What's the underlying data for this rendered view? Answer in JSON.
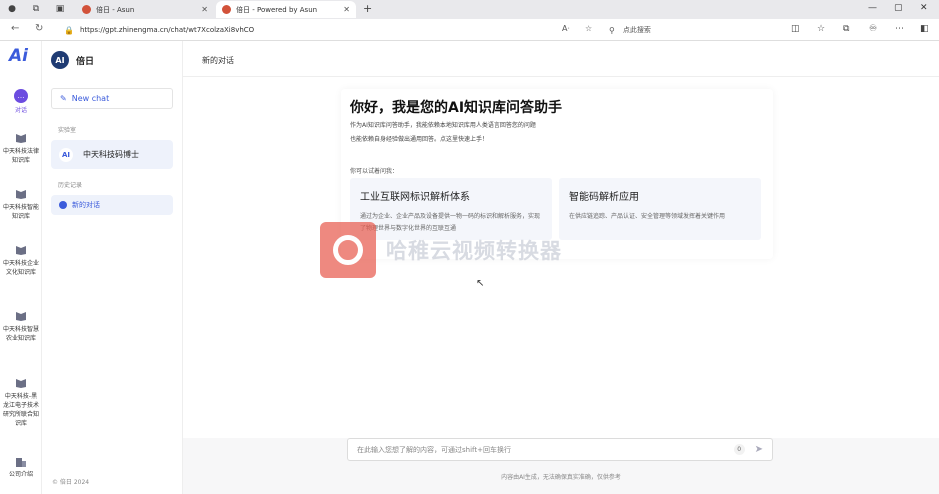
{
  "browser": {
    "tabs": [
      {
        "title": "倍日 - Asun",
        "active": false
      },
      {
        "title": "倍日 - Powered by Asun",
        "active": true
      }
    ],
    "url": "https://gpt.zhinengma.cn/chat/wt7XcolzaXi8vhCO",
    "search_placeholder": "点此搜索"
  },
  "rail": {
    "logo": "Ai",
    "items": [
      {
        "label": "对话",
        "icon": "chat-icon",
        "active": true
      },
      {
        "label": "中天科技法律知识库",
        "icon": "book-icon"
      },
      {
        "label": "中天科技智能知识库",
        "icon": "book-icon"
      },
      {
        "label": "中天科技企业文化知识库",
        "icon": "book-icon"
      },
      {
        "label": "中天科技智慧农业知识库",
        "icon": "book-icon"
      },
      {
        "label": "中天科技-黑龙江电子技术研究所联合知识库",
        "icon": "book-icon"
      },
      {
        "label": "公司介绍",
        "icon": "building-icon"
      }
    ]
  },
  "sidebar": {
    "app_badge": "AI",
    "app_name": "倍日",
    "new_chat": "New chat",
    "lab_label": "实验室",
    "bot": {
      "badge": "AI",
      "name": "中天科技码博士"
    },
    "history_label": "历史记录",
    "history": [
      {
        "title": "新的对话"
      }
    ],
    "copyright": "© 倍日 2024"
  },
  "main": {
    "title": "新的对话",
    "welcome": {
      "title": "你好，我是您的AI知识库问答助手",
      "desc_line1": "作为AI知识库问答助手，我能依赖本地知识库用人类语言回答您的问题",
      "desc_line2": "也能依赖自身经验做出通用回答。点这里快速上手！",
      "try_label": "你可以试着问我：",
      "cards": [
        {
          "title": "工业互联网标识解析体系",
          "desc": "通过为企业、企业产品及设备提供一物一码的标识和解析服务，实现了物理世界与数字化世界的互联互通"
        },
        {
          "title": "智能码解析应用",
          "desc": "在供应链追踪、产品认证、安全管理等领域发挥着关键作用"
        }
      ]
    },
    "watermark": "哈稚云视频转换器",
    "composer": {
      "placeholder": "在此输入您想了解的内容，可通过shift+回车换行",
      "count": "0"
    },
    "disclaimer": "内容由AI生成，无法确保真实准确，仅供参考"
  }
}
